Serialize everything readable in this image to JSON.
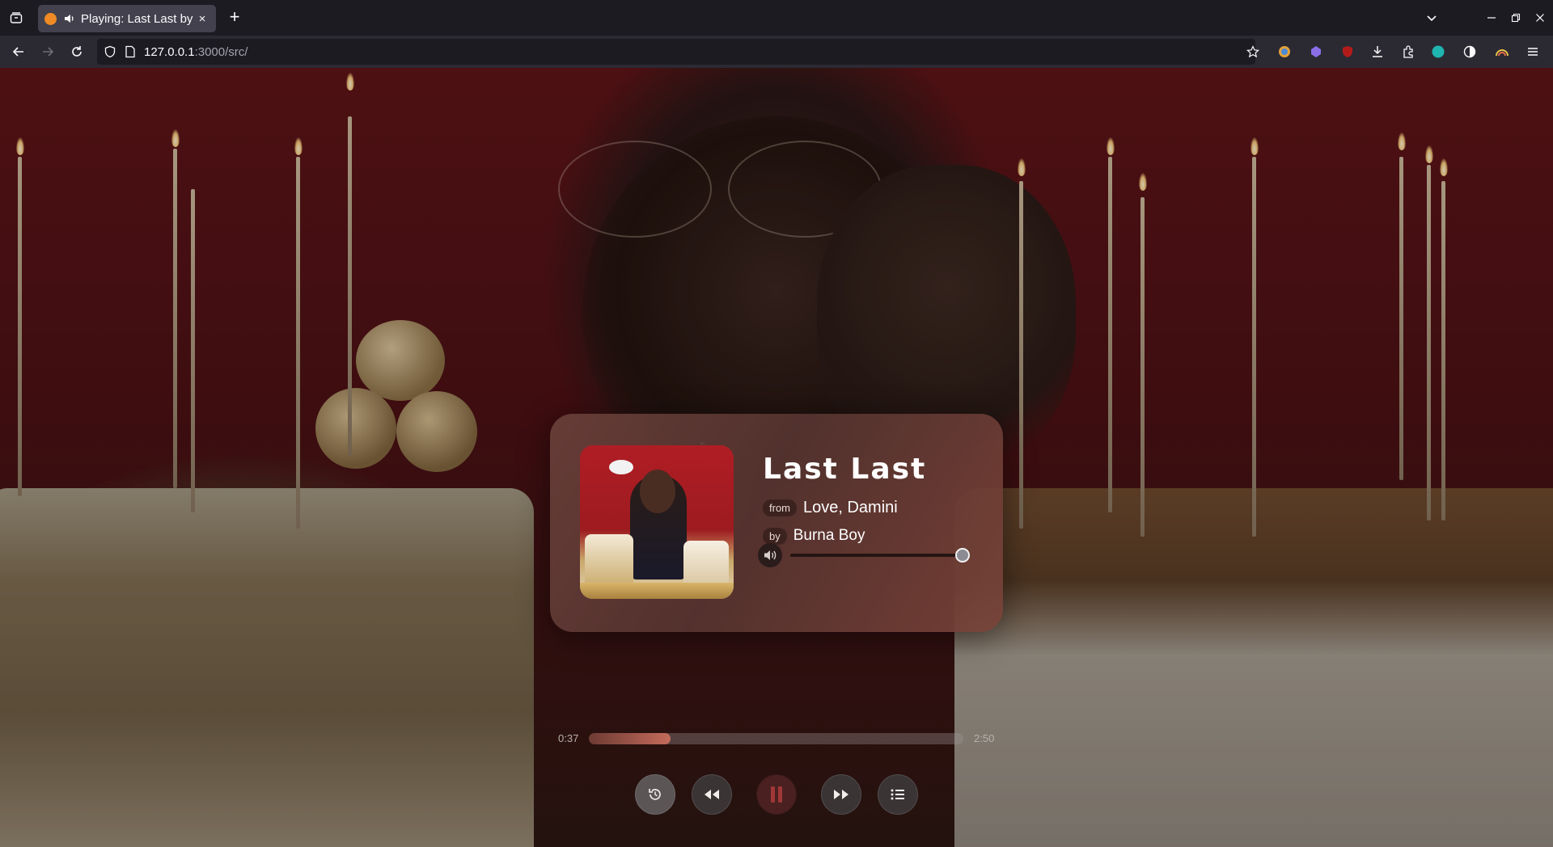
{
  "browser": {
    "tab": {
      "title": "Playing: Last Last by",
      "close_glyph": "×"
    },
    "new_tab_glyph": "+",
    "url": {
      "host": "127.0.0.1",
      "path": ":3000/src/"
    }
  },
  "player": {
    "title": "Last Last",
    "album_tag": "from",
    "album": "Love, Damini",
    "artist_tag": "by",
    "artist": "Burna Boy",
    "volume": 1.0,
    "elapsed": "0:37",
    "duration": "2:50",
    "progress": 0.218,
    "state": "playing"
  },
  "colors": {
    "accent_fill": "#c46b5b",
    "card": "#6a403a",
    "pause_icon": "#a03838"
  },
  "icons": {
    "restart": "history-icon",
    "previous": "rewind-icon",
    "play_pause": "pause-icon",
    "next": "fast-forward-icon",
    "playlist": "list-icon",
    "volume": "speaker-icon"
  }
}
